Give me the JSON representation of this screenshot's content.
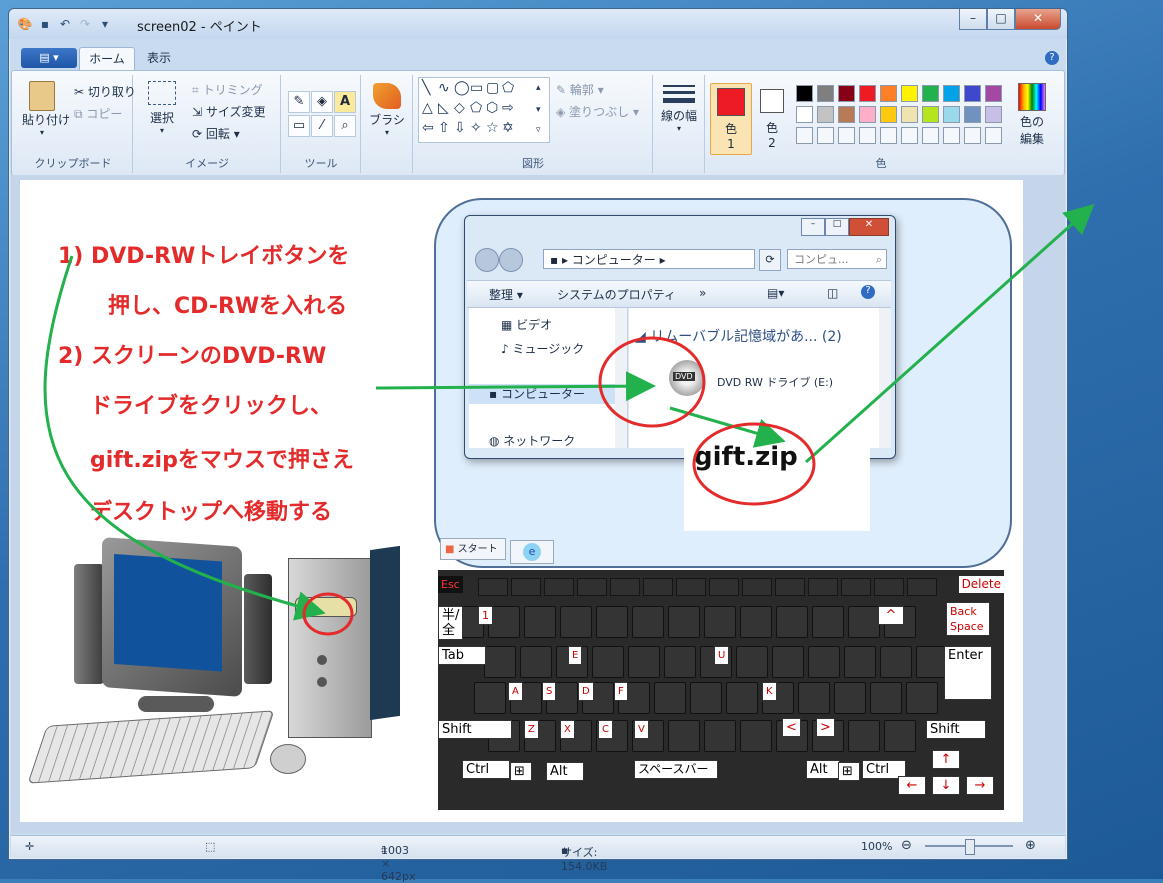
{
  "window": {
    "title": "screen02 - ペイント",
    "quick_access": [
      "save-icon",
      "undo-icon",
      "redo-icon",
      "dropdown-icon"
    ]
  },
  "tabs": {
    "file": "▾",
    "home": "ホーム",
    "view": "表示"
  },
  "ribbon": {
    "clipboard": {
      "paste": "貼り付け",
      "cut": "切り取り",
      "copy": "コピー",
      "label": "クリップボード"
    },
    "image": {
      "select": "選択",
      "crop": "トリミング",
      "resize": "サイズ変更",
      "rotate": "回転",
      "label": "イメージ"
    },
    "tools": {
      "label": "ツール"
    },
    "brush": {
      "label": "ブラシ"
    },
    "shapes": {
      "outline": "輪郭",
      "fill": "塗りつぶし",
      "label": "図形"
    },
    "size": {
      "label": "線の幅"
    },
    "colors": {
      "color1": "色",
      "color1_num": "1",
      "color2": "色",
      "color2_num": "2",
      "edit": "色の",
      "edit2": "編集",
      "label": "色",
      "color1_value": "#ed1c24",
      "color2_value": "#ffffff",
      "palette": [
        "#000000",
        "#7f7f7f",
        "#880015",
        "#ed1c24",
        "#ff7f27",
        "#fff200",
        "#22b14c",
        "#00a2e8",
        "#3f48cc",
        "#a349a4",
        "#ffffff",
        "#c3c3c3",
        "#b97a57",
        "#ffaec9",
        "#ffc90e",
        "#efe4b0",
        "#b5e61d",
        "#99d9ea",
        "#7092be",
        "#c8bfe7"
      ]
    }
  },
  "instructions": {
    "line1": "1) DVD-RWトレイボタンを",
    "line2": "押し、CD-RWを入れる",
    "line3": "2) スクリーンのDVD-RW",
    "line4": "ドライブをクリックし、",
    "line5": "gift.zipをマウスで押さえ",
    "line6": "デスクトップへ移動する"
  },
  "explorer": {
    "path_item": "コンピューター",
    "search_placeholder": "コンピュ...",
    "organize": "整理",
    "system_properties": "システムのプロパティ",
    "more": "»",
    "nav": [
      "ビデオ",
      "ミュージック",
      "コンピューター",
      "ネットワーク"
    ],
    "removable": "リムーバブル記憶域があ... (2)",
    "drive_label": "DVD RW ドライブ (E:)",
    "dvd_badge": "DVD"
  },
  "gift": "gift.zip",
  "taskbar": {
    "start": "スタート",
    "ie": "e"
  },
  "keyboard": {
    "esc": "Esc",
    "delete": "Delete",
    "hankaku_a": "半/",
    "hankaku_b": "全",
    "one": "1",
    "caret": "^",
    "backspace_a": "Back",
    "backspace_b": "Space",
    "tab": "Tab",
    "enter": "Enter",
    "e": "E",
    "u": "U",
    "a": "A",
    "s": "S",
    "d": "D",
    "f": "F",
    "k": "K",
    "shift": "Shift",
    "z": "Z",
    "x": "X",
    "c": "C",
    "v": "V",
    "lt": "<",
    "gt": ">",
    "ctrl": "Ctrl",
    "alt": "Alt",
    "space": "スペースバー",
    "up": "↑",
    "left": "←",
    "down": "↓",
    "right": "→"
  },
  "status": {
    "dimensions": "1003 × 642px",
    "size": "サイズ: 154.0KB",
    "zoom": "100%",
    "zoom_level": 0.5
  }
}
